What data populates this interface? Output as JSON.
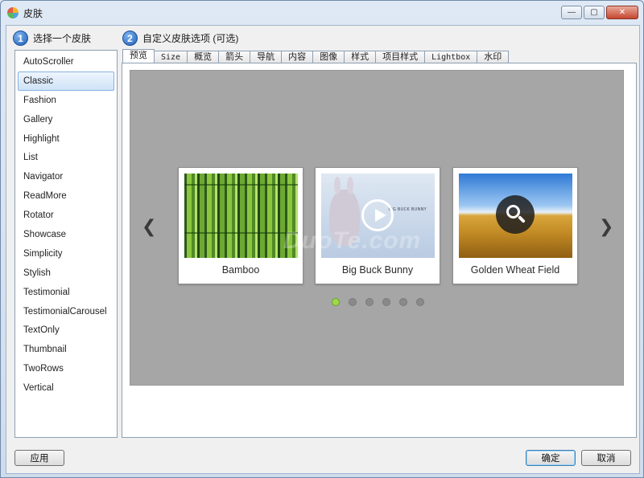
{
  "window": {
    "title": "皮肤"
  },
  "steps": [
    {
      "number": "1",
      "label": "选择一个皮肤"
    },
    {
      "number": "2",
      "label": "自定义皮肤选项 (可选)"
    }
  ],
  "skins": [
    {
      "label": "AutoScroller"
    },
    {
      "label": "Classic"
    },
    {
      "label": "Fashion"
    },
    {
      "label": "Gallery"
    },
    {
      "label": "Highlight"
    },
    {
      "label": "List"
    },
    {
      "label": "Navigator"
    },
    {
      "label": "ReadMore"
    },
    {
      "label": "Rotator"
    },
    {
      "label": "Showcase"
    },
    {
      "label": "Simplicity"
    },
    {
      "label": "Stylish"
    },
    {
      "label": "Testimonial"
    },
    {
      "label": "TestimonialCarousel"
    },
    {
      "label": "TextOnly"
    },
    {
      "label": "Thumbnail"
    },
    {
      "label": "TwoRows"
    },
    {
      "label": "Vertical"
    }
  ],
  "selected_skin": "Classic",
  "tabs": [
    {
      "label": "预览"
    },
    {
      "label": "Size"
    },
    {
      "label": "概览"
    },
    {
      "label": "箭头"
    },
    {
      "label": "导航"
    },
    {
      "label": "内容"
    },
    {
      "label": "图像"
    },
    {
      "label": "样式"
    },
    {
      "label": "项目样式"
    },
    {
      "label": "Lightbox"
    },
    {
      "label": "水印"
    }
  ],
  "preview": {
    "items": [
      {
        "caption": "Bamboo"
      },
      {
        "caption": "Big Buck Bunny",
        "thumb_text": "BIG BUCK BUNNY"
      },
      {
        "caption": "Golden Wheat Field"
      }
    ],
    "dots_count": 6,
    "active_dot": 0,
    "watermark": "DuoTe.com",
    "left_arrow": "❮",
    "right_arrow": "❯"
  },
  "buttons": {
    "apply": "应用",
    "ok": "确定",
    "cancel": "取消"
  },
  "colors": {
    "stage_bg": "#a6a6a6",
    "active_dot": "#9fd84a",
    "step_badge": "#1f5fb8"
  }
}
